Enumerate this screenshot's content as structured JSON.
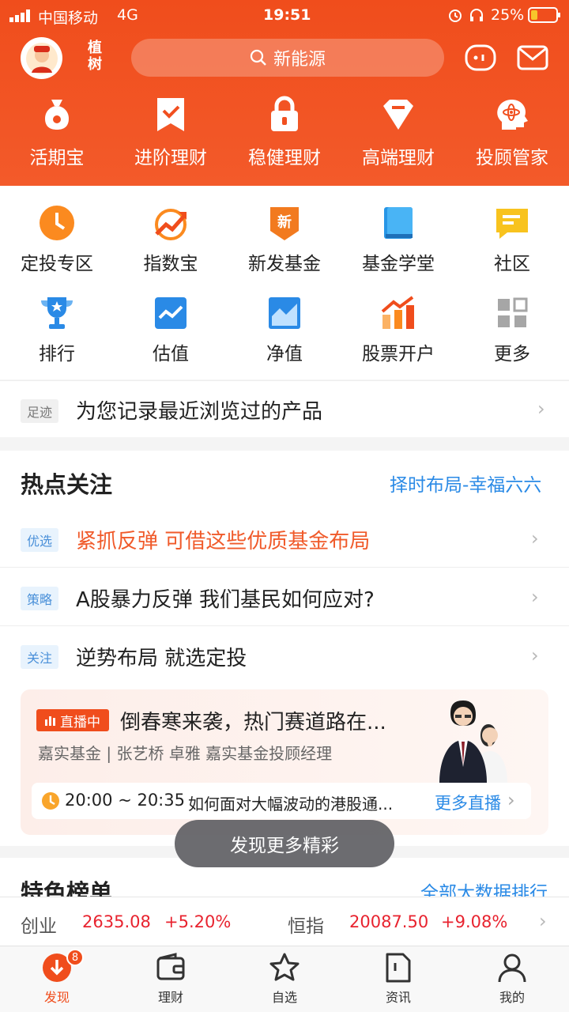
{
  "status_bar": {
    "carrier": "中国移动",
    "network": "4G",
    "time": "19:51",
    "battery": "25%"
  },
  "header": {
    "logo_text_1": "植",
    "logo_text_2": "树",
    "search_placeholder": "新能源",
    "nav": [
      {
        "label": "活期宝",
        "icon": "money-bag-icon"
      },
      {
        "label": "进阶理财",
        "icon": "bookmark-check-icon"
      },
      {
        "label": "稳健理财",
        "icon": "lock-icon"
      },
      {
        "label": "高端理财",
        "icon": "diamond-icon"
      },
      {
        "label": "投顾管家",
        "icon": "advisor-head-icon"
      }
    ]
  },
  "grid": [
    {
      "label": "定投专区",
      "icon": "clock-icon"
    },
    {
      "label": "指数宝",
      "icon": "trend-up-icon"
    },
    {
      "label": "新发基金",
      "icon": "new-badge-icon",
      "badge": "新"
    },
    {
      "label": "基金学堂",
      "icon": "book-icon"
    },
    {
      "label": "社区",
      "icon": "chat-icon"
    },
    {
      "label": "排行",
      "icon": "trophy-icon"
    },
    {
      "label": "估值",
      "icon": "valuation-chart-icon"
    },
    {
      "label": "净值",
      "icon": "area-chart-icon"
    },
    {
      "label": "股票开户",
      "icon": "stock-chart-icon"
    },
    {
      "label": "更多",
      "icon": "grid-more-icon"
    }
  ],
  "footprint": {
    "tag": "足迹",
    "text": "为您记录最近浏览过的产品"
  },
  "hot": {
    "title": "热点关注",
    "right_link": "择时布局-幸福六六",
    "items": [
      {
        "tag": "优选",
        "text": "紧抓反弹 可借这些优质基金布局"
      },
      {
        "tag": "策略",
        "text": "A股暴力反弹 我们基民如何应对?"
      },
      {
        "tag": "关注",
        "text": "逆势布局 就选定投"
      }
    ]
  },
  "live": {
    "badge": "直播中",
    "title": "倒春寒来袭，热门赛道路在...",
    "subtitle": "嘉实基金 | 张艺桥 卓雅 嘉实基金投顾经理",
    "time": "20:00 ~ 20:35",
    "topic": "如何面对大幅波动的港股通...",
    "more": "更多直播"
  },
  "discover_more": "发现更多精彩",
  "special": {
    "title": "特色榜单",
    "right_link": "全部大数据排行"
  },
  "ticker": [
    {
      "name": "创业",
      "value": "2635.08",
      "change": "+5.20%"
    },
    {
      "name": "恒指",
      "value": "20087.50",
      "change": "+9.08%"
    }
  ],
  "tabs": [
    {
      "label": "发现",
      "badge": "8"
    },
    {
      "label": "理财"
    },
    {
      "label": "自选"
    },
    {
      "label": "资讯"
    },
    {
      "label": "我的"
    }
  ],
  "colors": {
    "brand": "#f04d1c",
    "up": "#e8232f",
    "link": "#2a8ae6"
  }
}
